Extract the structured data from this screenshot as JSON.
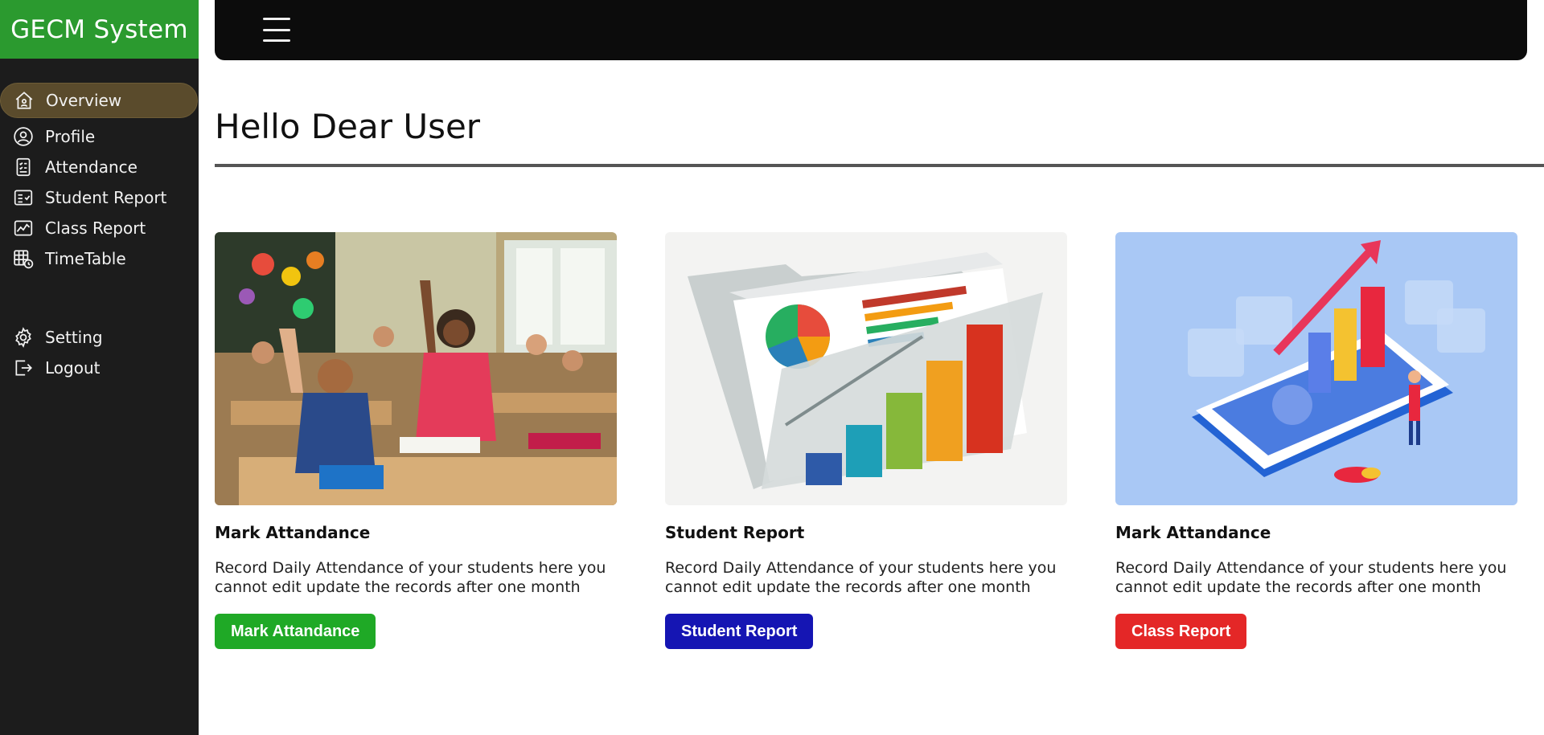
{
  "brand": {
    "title": "GECM System"
  },
  "sidebar": {
    "items": [
      {
        "label": "Overview",
        "icon": "home-icon",
        "active": true
      },
      {
        "label": "Profile",
        "icon": "user-circle-icon"
      },
      {
        "label": "Attendance",
        "icon": "attendance-icon"
      },
      {
        "label": "Student Report",
        "icon": "report-icon"
      },
      {
        "label": "Class Report",
        "icon": "chart-icon"
      },
      {
        "label": "TimeTable",
        "icon": "timetable-icon"
      }
    ],
    "bottom_items": [
      {
        "label": "Setting",
        "icon": "gear-icon"
      },
      {
        "label": "Logout",
        "icon": "logout-icon"
      }
    ]
  },
  "topbar": {
    "menu_icon": "hamburger-icon"
  },
  "main": {
    "greeting": "Hello Dear User",
    "cards": [
      {
        "title": "Mark Attandance",
        "description": "Record Daily Attendance of your students here you cannot edit update the records after one month",
        "button": "Mark Attandance",
        "button_color": "#1fa926",
        "image": "classroom-photo"
      },
      {
        "title": "Student Report",
        "description": "Record Daily Attendance of your students here you cannot edit update the records after one month",
        "button": "Student Report",
        "button_color": "#1515b3",
        "image": "report-folder-illustration"
      },
      {
        "title": "Mark Attandance",
        "description": "Record Daily Attendance of your students here you cannot edit update the records after one month",
        "button": "Class Report",
        "button_color": "#e42727",
        "image": "analytics-phone-illustration"
      }
    ]
  },
  "colors": {
    "brand": "#2b9a2f",
    "sidebar": "#1c1c1c",
    "active_item": "#5a4b2c",
    "topbar": "#0c0c0c"
  }
}
